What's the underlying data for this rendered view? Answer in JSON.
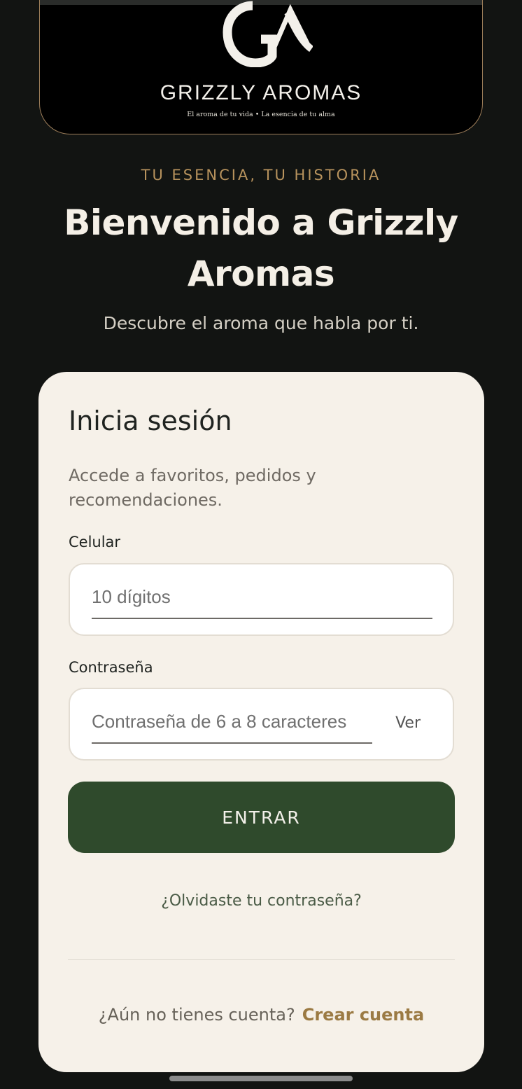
{
  "brand": {
    "monogram": "GA",
    "name": "GRIZZLY AROMAS",
    "tagline": "El aroma de tu vida • La esencia de tu alma"
  },
  "hero": {
    "eyebrow": "TU ESENCIA, TU HISTORIA",
    "title": "Bienvenido a Grizzly Aromas",
    "subtitle": "Descubre el aroma que habla por ti."
  },
  "login": {
    "title": "Inicia sesión",
    "description": "Accede a favoritos, pedidos y recomendaciones.",
    "phone_label": "Celular",
    "phone_placeholder": "10 dígitos",
    "phone_value": "",
    "password_label": "Contraseña",
    "password_placeholder": "Contraseña de 6 a 8 caracteres",
    "password_value": "",
    "show_password_label": "Ver",
    "submit_label": "ENTRAR",
    "forgot_label": "¿Olvidaste tu contraseña?",
    "signup_prompt": "¿Aún no tienes cuenta?",
    "signup_link": "Crear cuenta"
  },
  "colors": {
    "background": "#121412",
    "card": "#f6f1e9",
    "accent_gold": "#b8935d",
    "primary_green": "#2f4a2c"
  }
}
